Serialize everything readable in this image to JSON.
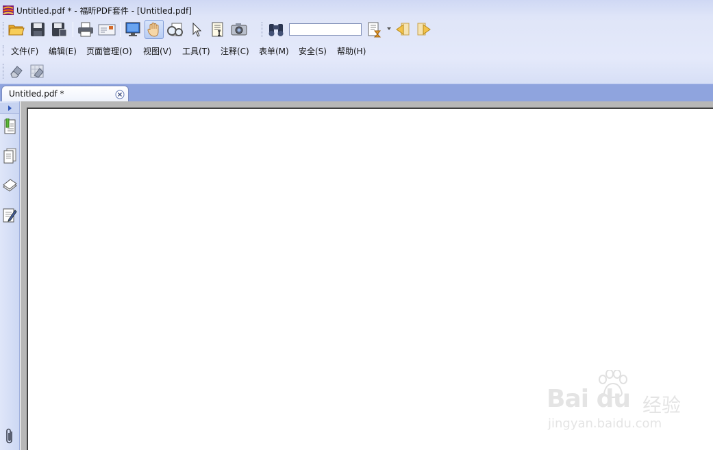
{
  "window": {
    "title": "Untitled.pdf * - 福昕PDF套件 - [Untitled.pdf]",
    "icon": "foxit-app-icon"
  },
  "toolbar": {
    "buttons": [
      {
        "name": "open-folder-icon"
      },
      {
        "name": "save-icon"
      },
      {
        "name": "save-as-icon"
      },
      {
        "name": "print-icon"
      },
      {
        "name": "email-icon"
      },
      {
        "name": "fullscreen-monitor-icon"
      },
      {
        "name": "hand-tool-icon",
        "pressed": true
      },
      {
        "name": "loupe-icon"
      },
      {
        "name": "select-arrow-icon"
      },
      {
        "name": "select-text-icon"
      },
      {
        "name": "snapshot-camera-icon"
      },
      {
        "name": "find-binoculars-icon"
      },
      {
        "name": "search-options-icon"
      },
      {
        "name": "previous-result-icon"
      },
      {
        "name": "next-result-icon"
      }
    ],
    "search": {
      "value": "",
      "placeholder": ""
    }
  },
  "menu": {
    "items": [
      "文件(F)",
      "编辑(E)",
      "页面管理(O)",
      "视图(V)",
      "工具(T)",
      "注释(C)",
      "表单(M)",
      "安全(S)",
      "帮助(H)"
    ]
  },
  "toolbar2": {
    "buttons": [
      {
        "name": "eraser-icon"
      },
      {
        "name": "pattern-eraser-icon"
      }
    ]
  },
  "tabs": [
    {
      "label": "Untitled.pdf *",
      "active": true
    }
  ],
  "side_panel": {
    "buttons": [
      "bookmarks-icon",
      "pages-icon",
      "layers-icon",
      "annotations-icon"
    ],
    "bottom": "attachments-paperclip-icon"
  },
  "watermark": {
    "brand": "Bai du",
    "sub": "经验",
    "url": "jingyan.baidu.com"
  },
  "colors": {
    "chrome_top": "#cfd8f4",
    "tabstrip": "#8fa4de",
    "canvas_border": "#b7b7b7"
  }
}
